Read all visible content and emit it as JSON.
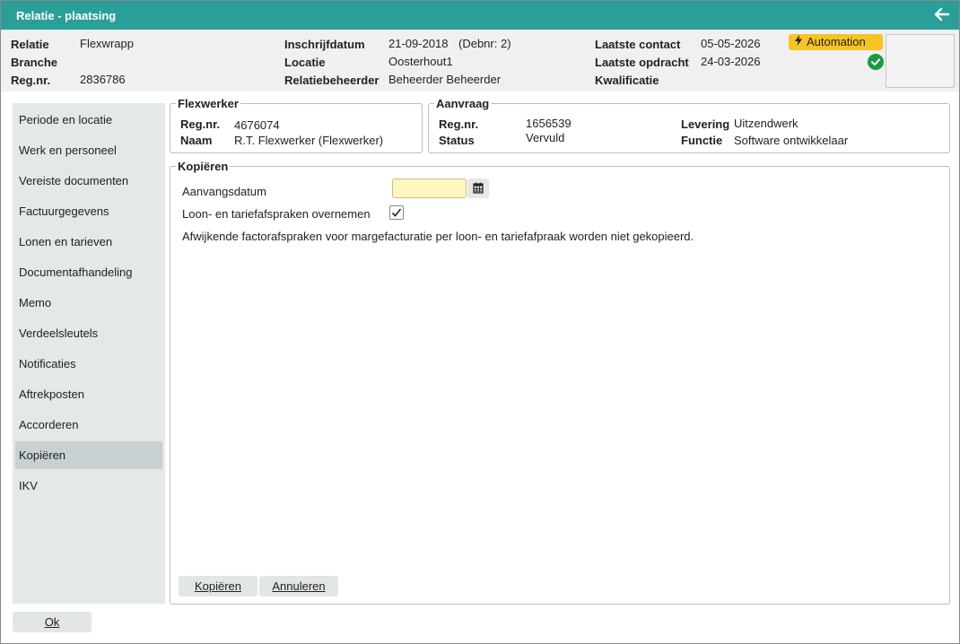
{
  "window": {
    "title": "Relatie - plaatsing"
  },
  "header": {
    "relatie_label": "Relatie",
    "relatie_value": "Flexwrapp",
    "branche_label": "Branche",
    "regnr_label": "Reg.nr.",
    "regnr_value": "2836786",
    "inschrijfdatum_label": "Inschrijfdatum",
    "inschrijfdatum_value": "21-09-2018",
    "debnr_value": "(Debnr: 2)",
    "locatie_label": "Locatie",
    "locatie_value": "Oosterhout1",
    "beheerder_label": "Relatiebeheerder",
    "beheerder_value": "Beheerder Beheerder",
    "laatste_contact_label": "Laatste contact",
    "laatste_contact_value": "05-05-2026",
    "laatste_opdracht_label": "Laatste opdracht",
    "laatste_opdracht_value": "24-03-2026",
    "kwalificatie_label": "Kwalificatie",
    "badge_label": "Automation"
  },
  "sidebar": {
    "items": [
      {
        "label": "Periode en locatie"
      },
      {
        "label": "Werk en personeel"
      },
      {
        "label": "Vereiste documenten"
      },
      {
        "label": "Factuurgegevens"
      },
      {
        "label": "Lonen en tarieven"
      },
      {
        "label": "Documentafhandeling"
      },
      {
        "label": "Memo"
      },
      {
        "label": "Verdeelsleutels"
      },
      {
        "label": "Notificaties"
      },
      {
        "label": "Aftrekposten"
      },
      {
        "label": "Accorderen"
      },
      {
        "label": "Kopiëren",
        "active": true
      },
      {
        "label": "IKV"
      }
    ]
  },
  "flexwerker": {
    "legend": "Flexwerker",
    "regnr_label": "Reg.nr.",
    "regnr_value": "4676074",
    "naam_label": "Naam",
    "naam_value": "R.T. Flexwerker (Flexwerker)"
  },
  "aanvraag": {
    "legend": "Aanvraag",
    "regnr_label": "Reg.nr.",
    "regnr_value": "1656539",
    "status_label": "Status",
    "status_value": "Vervuld",
    "levering_label": "Levering",
    "levering_value": "Uitzendwerk",
    "functie_label": "Functie",
    "functie_value": "Software ontwikkelaar"
  },
  "kopieren": {
    "legend": "Kopiëren",
    "aanvangsdatum_label": "Aanvangsdatum",
    "aanvangsdatum_value": "",
    "loon_label": "Loon- en tariefafspraken overnemen",
    "loon_checked": true,
    "info_text": "Afwijkende factorafspraken voor margefacturatie per loon- en tariefafpraak worden niet gekopieerd.",
    "kopieren_button": "Kopiëren",
    "annuleren_button": "Annuleren"
  },
  "footer": {
    "ok_button": "Ok"
  },
  "colors": {
    "titlebar": "#2a9f9a",
    "badge": "#f7c325",
    "date_input": "#fff6c2",
    "success": "#1e9a3e"
  }
}
